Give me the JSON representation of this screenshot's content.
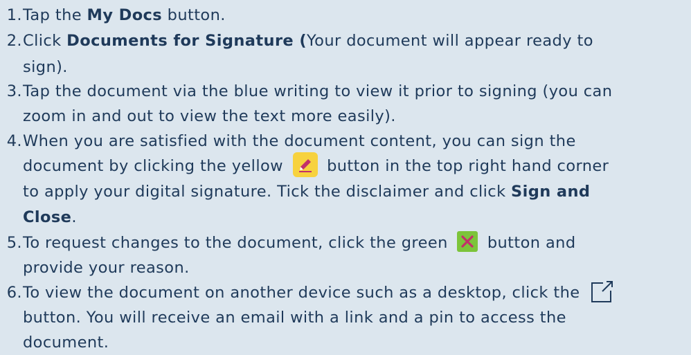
{
  "steps": [
    {
      "num": "1.",
      "lines": [
        [
          "Tap the ",
          {
            "b": "My Docs"
          },
          " button."
        ]
      ]
    },
    {
      "num": "2.",
      "lines": [
        [
          "Click ",
          {
            "b": "Documents for Signature ("
          },
          "Your document will appear ready to"
        ],
        [
          "sign)."
        ]
      ]
    },
    {
      "num": "3.",
      "lines": [
        [
          "Tap the document via the blue writing to view it prior to signing (you can"
        ],
        [
          "zoom in and out to view the text more easily)."
        ]
      ]
    },
    {
      "num": "4.",
      "lines": [
        [
          "When you are satisfied with the document content, you can sign the"
        ],
        [
          "document by clicking the yellow ",
          {
            "icon": "pencil-icon"
          },
          " button in the top right hand corner"
        ],
        [
          "to apply your digital signature. Tick the disclaimer and click ",
          {
            "b": "Sign and"
          }
        ],
        [
          {
            "b": "Close"
          },
          "."
        ]
      ]
    },
    {
      "num": "5.",
      "lines": [
        [
          "To request changes to the document, click the green ",
          {
            "icon": "x-icon"
          },
          " button and"
        ],
        [
          "provide your reason."
        ]
      ]
    },
    {
      "num": "6.",
      "lines": [
        [
          "To view the document on another device such as a desktop, click the ",
          {
            "icon": "external-link-icon"
          }
        ],
        [
          "button. You will receive an email with a link and a pin to access the"
        ],
        [
          "document."
        ]
      ]
    }
  ],
  "colors": {
    "background": "#dce6ee",
    "text": "#1f3a5a",
    "pencil_button": "#f7d23e",
    "x_button": "#7cc43a"
  }
}
